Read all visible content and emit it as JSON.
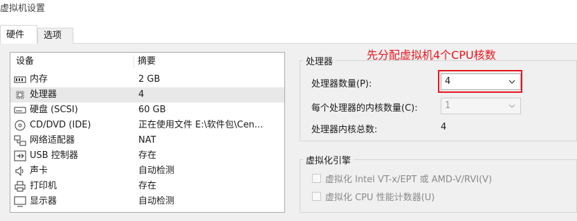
{
  "window": {
    "title": "虚拟机设置"
  },
  "tabs": [
    {
      "label": "硬件"
    },
    {
      "label": "选项"
    }
  ],
  "device_list": {
    "col_device": "设备",
    "col_summary": "摘要",
    "rows": [
      {
        "icon": "memory-icon",
        "name": "内存",
        "summary": "2 GB"
      },
      {
        "icon": "processor-icon",
        "name": "处理器",
        "summary": "4"
      },
      {
        "icon": "hard-disk-icon",
        "name": "硬盘 (SCSI)",
        "summary": "60 GB"
      },
      {
        "icon": "cd-dvd-icon",
        "name": "CD/DVD (IDE)",
        "summary": "正在使用文件 E:\\软件包\\Cen..."
      },
      {
        "icon": "network-adapter-icon",
        "name": "网络适配器",
        "summary": "NAT"
      },
      {
        "icon": "usb-icon",
        "name": "USB 控制器",
        "summary": "存在"
      },
      {
        "icon": "sound-card-icon",
        "name": "声卡",
        "summary": "自动检测"
      },
      {
        "icon": "printer-icon",
        "name": "打印机",
        "summary": "存在"
      },
      {
        "icon": "display-icon",
        "name": "显示器",
        "summary": "自动检测"
      }
    ]
  },
  "processor": {
    "group_title": "处理器",
    "count_label": "处理器数量(P):",
    "count_value": "4",
    "cores_label": "每个处理器的内核数量(C):",
    "cores_value": "1",
    "total_label": "处理器内核总数:",
    "total_value": "4"
  },
  "virtualization": {
    "group_title": "虚拟化引擎",
    "option1": "虚拟化 Intel VT-x/EPT 或 AMD-V/RVI(V)",
    "option2": "虚拟化 CPU 性能计数器(U)"
  },
  "annotation": {
    "text": "先分配虚拟机4个CPU核数",
    "color": "#e8151c"
  }
}
